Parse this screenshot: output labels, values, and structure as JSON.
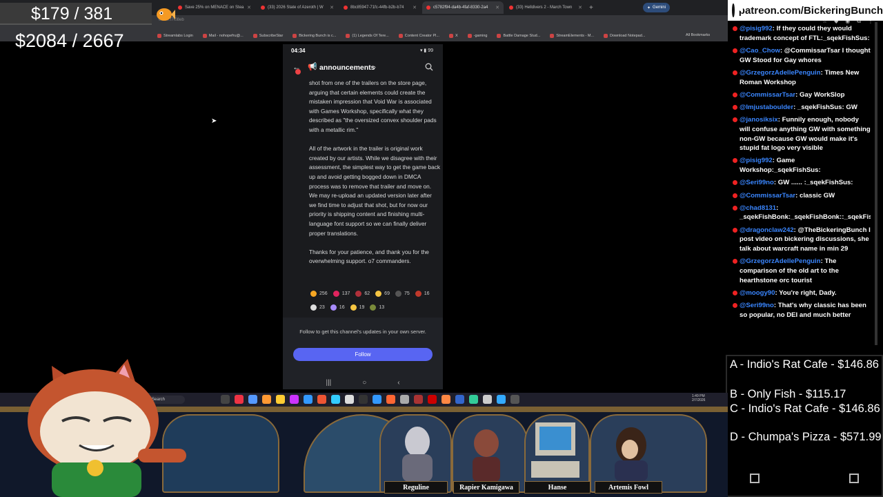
{
  "overlay": {
    "goal_top": "$179 / 381",
    "goal_bottom": "$2084 / 2667"
  },
  "browser": {
    "tabs": [
      {
        "title": "Save 25% on MENACE on Stea",
        "active": false
      },
      {
        "title": "(33) 2026 State of Azeroth | W",
        "active": false
      },
      {
        "title": "8bc85947-71fc-44fb-b2b-b74",
        "active": false
      },
      {
        "title": "c5782f94-da4b-4faf-8330-2a4",
        "active": true
      },
      {
        "title": "(33) Helldivers 2 - March Town",
        "active": false
      }
    ],
    "gemini_label": "Gemini",
    "url_fragment": "0fd0...f7f08eb",
    "bookmarks": [
      "Streamlabs Login",
      "Mail - nohopefru@...",
      "SubscribeStar",
      "Bickering Bunch is c...",
      "(1) Legends Of Tere...",
      "Content Creator Pl...",
      "X",
      "-gaming",
      "Battle Damage Stud...",
      "StreamElements - M...",
      "Download Notepad..."
    ],
    "all_bookmarks": "All Bookmarks"
  },
  "phone": {
    "time": "04:34",
    "battery": "99",
    "channel_name": "announcements",
    "badge_count": "4",
    "message_paragraphs": [
      "shot from one of the trailers on the store page, arguing that certain elements could create the mistaken impression that Void War is associated with Games Workshop, specifically what they described as \"the oversized convex shoulder pads with a metallic rim.\"",
      "All of the artwork in the trailer is original work created by our artists. While we disagree with their assessment, the simplest way to get the game back up and avoid getting bogged down in DMCA process was to remove that trailer and move on. We may re-upload an updated version later after we find time to adjust that shot, but for now our priority is shipping content and finishing multi-language font support so we can finally deliver proper translations.",
      "Thanks for your patience, and thank you for the overwhelming support. o7 commanders."
    ],
    "reactions": [
      {
        "count": "256",
        "color": "#f5a623"
      },
      {
        "count": "137",
        "color": "#e0245e"
      },
      {
        "count": "62",
        "color": "#b0303a"
      },
      {
        "count": "69",
        "color": "#f5c542"
      },
      {
        "count": "75",
        "color": "#555555"
      },
      {
        "count": "16",
        "color": "#c0392b"
      },
      {
        "count": "23",
        "color": "#dddddd"
      },
      {
        "count": "16",
        "color": "#a78bfa"
      },
      {
        "count": "19",
        "color": "#f5c542"
      },
      {
        "count": "13",
        "color": "#7a8b3a"
      }
    ],
    "follow_text": "Follow to get this channel's updates in your own server.",
    "follow_button": "Follow"
  },
  "patreon": {
    "handle": "patreon.com/BickeringBunch"
  },
  "chat": [
    {
      "user": "@pisig992",
      "text": ": If they could they would trademark concept of FTL:_sqekFishSus:"
    },
    {
      "user": "@Cao_Chow",
      "text": ": @CommissarTsar I thought GW Stood for Gay whores"
    },
    {
      "user": "@GrzegorzAdellePenguin",
      "text": ": Times New Roman Workshop"
    },
    {
      "user": "@CommissarTsar",
      "text": ": Gay WorkSlop"
    },
    {
      "user": "@Imjustaboulder",
      "text": ": _sqekFishSus: GW"
    },
    {
      "user": "@janosiksix",
      "text": ": Funnily enough, nobody will confuse anything GW with something non-GW because GW would make it's stupid fat logo very visible"
    },
    {
      "user": "@pisig992",
      "text": ": Game Workshop:_sqekFishSus:"
    },
    {
      "user": "@Seri99no",
      "text": ": GW ...... :_sqekFishSus:"
    },
    {
      "user": "@CommissarTsar",
      "text": ": classic GW"
    },
    {
      "user": "@chad8131",
      "text": ": _sqekFishBonk:_sqekFishBonk::_sqekFishBonk::_sqekFishBonk::_sqekFishBonk::_sqekFishBonk::_sqekFishBonk:GW"
    },
    {
      "user": "@dragonclaw242",
      "text": ": @TheBickeringBunch I post video on bickering discussions, she talk about warcraft name in min 29"
    },
    {
      "user": "@GrzegorzAdellePenguin",
      "text": ": The comparison of the old art to the hearthstone orc tourist"
    },
    {
      "user": "@moogy90",
      "text": ": You're right, Dady."
    },
    {
      "user": "@Seri99no",
      "text": ": That's why classic has been so popular, no DEI and much better"
    }
  ],
  "poll": [
    "A - Indio's Rat Cafe - $146.86",
    "B - Only Fish - $115.17",
    "C - Indio's Rat Cafe - $146.86",
    "D - Chumpa's Pizza - $571.99"
  ],
  "taskbar": {
    "search_label": "Search",
    "time": "1:49 PM",
    "date": "2/7/2026"
  },
  "characters": [
    "Reguline",
    "Rapier Kamigawa",
    "Hanse",
    "Artemis Fowl"
  ]
}
